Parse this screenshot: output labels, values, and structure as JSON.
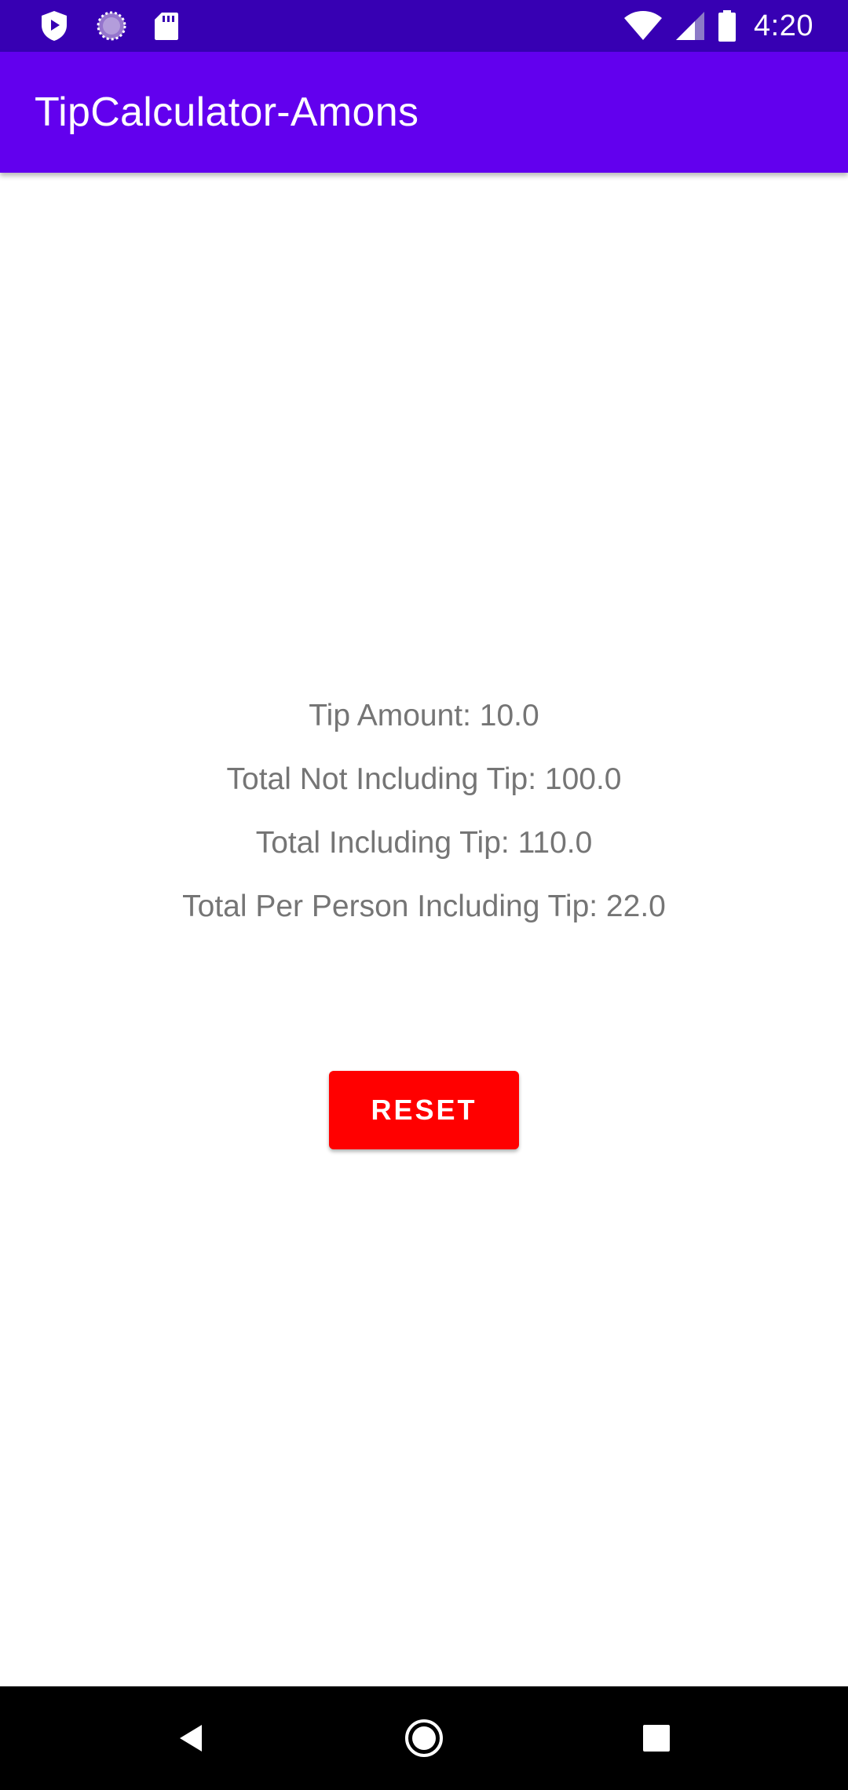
{
  "status_bar": {
    "time": "4:20",
    "left_icons": [
      "shield-notification-icon",
      "sync-circle-icon",
      "sd-card-icon"
    ],
    "right_icons": [
      "wifi-icon",
      "cell-signal-icon",
      "battery-icon"
    ],
    "background": "#3700b3"
  },
  "app_bar": {
    "title": "TipCalculator-Amons",
    "background": "#6200ee"
  },
  "results": {
    "tip_amount": "Tip Amount: 10.0",
    "total_not_including_tip": "Total Not Including Tip: 100.0",
    "total_including_tip": "Total Including Tip: 110.0",
    "total_per_person": "Total Per Person Including Tip: 22.0"
  },
  "reset_button": {
    "label": "RESET",
    "color": "#ff0000"
  },
  "nav_bar": {
    "buttons": [
      "back-icon",
      "home-icon",
      "recents-icon"
    ],
    "background": "#000000"
  }
}
